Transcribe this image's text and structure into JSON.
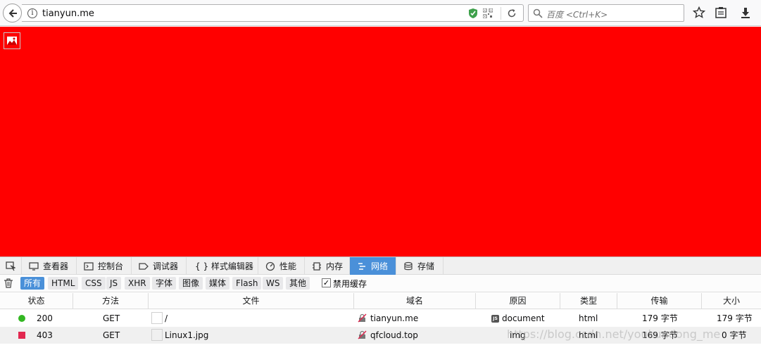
{
  "browser": {
    "url": "tianyun.me",
    "search_placeholder": "百度 <Ctrl+K>"
  },
  "page": {
    "background": "#ff0000"
  },
  "devtools": {
    "tabs": [
      {
        "label": "查看器",
        "icon": "inspector-icon"
      },
      {
        "label": "控制台",
        "icon": "console-icon"
      },
      {
        "label": "调试器",
        "icon": "debugger-icon"
      },
      {
        "label": "{ } 样式编辑器",
        "icon": "style-editor-icon"
      },
      {
        "label": "性能",
        "icon": "performance-icon"
      },
      {
        "label": "内存",
        "icon": "memory-icon"
      },
      {
        "label": "网络",
        "icon": "network-icon",
        "active": true
      },
      {
        "label": "存储",
        "icon": "storage-icon"
      }
    ],
    "filters": [
      "所有",
      "HTML",
      "CSS",
      "JS",
      "XHR",
      "字体",
      "图像",
      "媒体",
      "Flash",
      "WS",
      "其他"
    ],
    "active_filter": "所有",
    "disable_cache_label": "禁用缓存",
    "disable_cache_checked": true,
    "columns": [
      "状态",
      "方法",
      "文件",
      "域名",
      "原因",
      "类型",
      "传输",
      "大小"
    ],
    "requests": [
      {
        "status": "200",
        "status_color": "#33b722",
        "method": "GET",
        "file": "/",
        "domain": "tianyun.me",
        "cause": "document",
        "cause_badge": "JS",
        "type": "html",
        "transferred": "179 字节",
        "size": "179 字节"
      },
      {
        "status": "403",
        "status_color": "#e22850",
        "method": "GET",
        "file": "Linux1.jpg",
        "domain": "qfcloud.top",
        "cause": "img",
        "type": "html",
        "transferred": "169 字节",
        "size": "0 字节"
      }
    ]
  },
  "watermark": "https://blog.csdn.net/youkundong_me"
}
